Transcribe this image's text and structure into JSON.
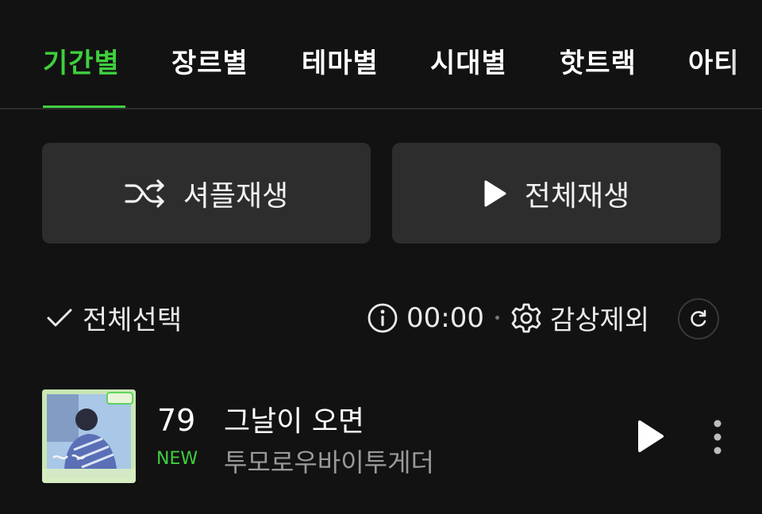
{
  "tabs": [
    {
      "label": "기간별",
      "active": true
    },
    {
      "label": "장르별",
      "active": false
    },
    {
      "label": "테마별",
      "active": false
    },
    {
      "label": "시대별",
      "active": false
    },
    {
      "label": "핫트랙",
      "active": false
    },
    {
      "label": "아티",
      "active": false
    }
  ],
  "actions": {
    "shuffle_label": "셔플재생",
    "shuffle_icon": "shuffle-icon",
    "play_all_label": "전체재생",
    "play_all_icon": "play-icon"
  },
  "toolbar": {
    "select_all_label": "전체선택",
    "select_all_icon": "check-icon",
    "time_icon": "info-icon",
    "time_value": "00:00",
    "exclude_label": "감상제외",
    "exclude_icon": "gear-icon",
    "refresh_icon": "refresh-icon"
  },
  "tracks": [
    {
      "rank": "79",
      "badge": "NEW",
      "title": "그날이 오면",
      "artist": "투모로우바이투게더"
    }
  ],
  "colors": {
    "accent": "#3ecf3e",
    "background": "#121212",
    "button_bg": "#2d2d2d",
    "secondary_text": "#9a9a9a"
  }
}
